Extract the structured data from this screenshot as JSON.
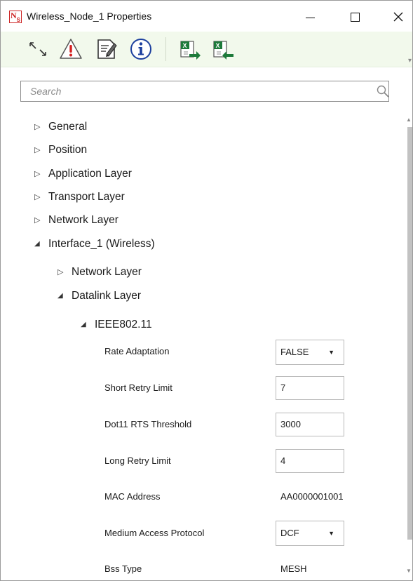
{
  "window": {
    "title": "Wireless_Node_1 Properties",
    "controls": {
      "minimize": "—",
      "maximize": "☐",
      "close": "✕"
    }
  },
  "toolbar": {
    "buttons": [
      {
        "icon": "expand-collapse-icon"
      },
      {
        "icon": "warning-icon"
      },
      {
        "icon": "edit-document-icon"
      },
      {
        "icon": "info-icon"
      },
      {
        "icon": "excel-export-icon"
      },
      {
        "icon": "excel-import-icon"
      }
    ],
    "colors": {
      "background": "#f2f9ec",
      "excel": "#1d7a3a",
      "warning": "#d42020",
      "info": "#1c3f9e"
    }
  },
  "search": {
    "placeholder": "Search",
    "value": ""
  },
  "tree": {
    "collapsed_arrow": "▷",
    "expanded_arrow": "◢",
    "items": [
      {
        "label": "General",
        "expanded": false
      },
      {
        "label": "Position",
        "expanded": false
      },
      {
        "label": "Application Layer",
        "expanded": false
      },
      {
        "label": "Transport Layer",
        "expanded": false
      },
      {
        "label": "Network Layer",
        "expanded": false
      },
      {
        "label": "Interface_1 (Wireless)",
        "expanded": true
      }
    ],
    "interface_children": [
      {
        "label": "Network Layer",
        "expanded": false
      },
      {
        "label": "Datalink Layer",
        "expanded": true
      }
    ],
    "datalink_children": [
      {
        "label": "IEEE802.11",
        "expanded": true
      }
    ]
  },
  "properties": [
    {
      "label": "Rate Adaptation",
      "type": "select",
      "value": "FALSE"
    },
    {
      "label": "Short Retry Limit",
      "type": "input",
      "value": "7"
    },
    {
      "label": "Dot11 RTS Threshold",
      "type": "input",
      "value": "3000"
    },
    {
      "label": "Long Retry Limit",
      "type": "input",
      "value": "4"
    },
    {
      "label": "MAC Address",
      "type": "text",
      "value": "AA0000001001"
    },
    {
      "label": "Medium Access Protocol",
      "type": "select",
      "value": "DCF"
    },
    {
      "label": "Bss Type",
      "type": "text",
      "value": "MESH"
    }
  ]
}
